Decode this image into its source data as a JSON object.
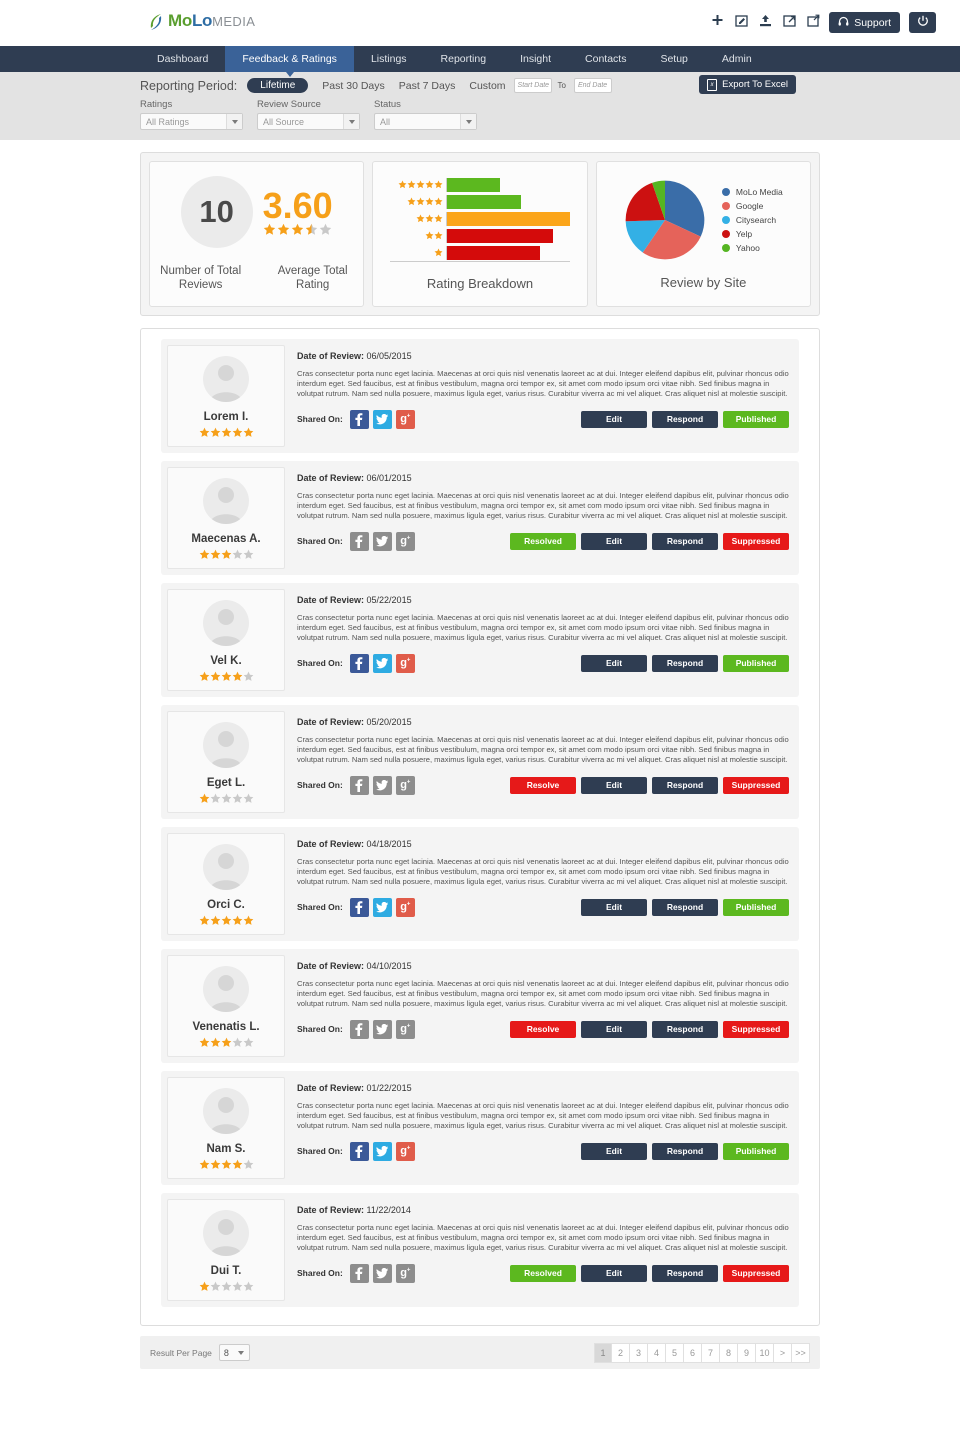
{
  "header": {
    "logo": {
      "part1": "Mo",
      "part2": "Lo",
      "part3": "MEDIA",
      "mark_icon": "swoosh-logo-icon"
    },
    "icons": [
      {
        "name": "add-icon",
        "glyph": "plus"
      },
      {
        "name": "compose-icon",
        "glyph": "edit-square"
      },
      {
        "name": "upload-icon",
        "glyph": "upload"
      },
      {
        "name": "external-link-icon",
        "glyph": "open-external"
      },
      {
        "name": "edit-external-icon",
        "glyph": "edit-external"
      }
    ],
    "support_label": "Support",
    "support_icon": "headset-icon",
    "power_icon": "power-icon"
  },
  "nav": {
    "items": [
      {
        "label": "Dashboard",
        "active": false
      },
      {
        "label": "Feedback & Ratings",
        "active": true
      },
      {
        "label": "Listings",
        "active": false
      },
      {
        "label": "Reporting",
        "active": false
      },
      {
        "label": "Insight",
        "active": false
      },
      {
        "label": "Contacts",
        "active": false
      },
      {
        "label": "Setup",
        "active": false
      },
      {
        "label": "Admin",
        "active": false
      }
    ],
    "active_color": "#3a6298",
    "bar_color": "#2f3d52"
  },
  "reporting_period": {
    "label": "Reporting Period:",
    "selected": "Lifetime",
    "options": [
      "Lifetime",
      "Past 30 Days",
      "Past 7 Days",
      "Custom"
    ],
    "start_date_placeholder": "Start Date",
    "to_label": "To",
    "end_date_placeholder": "End Date",
    "export_label": "Export To Excel",
    "export_icon": "excel-file-icon"
  },
  "filters": [
    {
      "label": "Ratings",
      "value": "All Ratings",
      "name": "ratings-filter"
    },
    {
      "label": "Review Source",
      "value": "All Source",
      "name": "review-source-filter"
    },
    {
      "label": "Status",
      "value": "All",
      "name": "status-filter"
    }
  ],
  "stats": {
    "total_reviews_value": "10",
    "total_reviews_label": "Number of Total Reviews",
    "average_rating_value": "3.60",
    "average_rating_label": "Average Total Rating",
    "average_rating_stars": 3.5,
    "accent_orange": "#f6a01a"
  },
  "chart_data": [
    {
      "type": "bar",
      "title": "Rating Breakdown",
      "orientation": "horizontal",
      "categories": [
        "5 stars",
        "4 stars",
        "3 stars",
        "2 stars",
        "1 star"
      ],
      "values": [
        43,
        60,
        100,
        86,
        76
      ],
      "colors": [
        "#5cb81f",
        "#5cb81f",
        "#fba51a",
        "#d40b0b",
        "#d40b0b"
      ],
      "xlabel": "",
      "ylabel": "",
      "xlim": [
        0,
        100
      ],
      "grid": false,
      "legend": false
    },
    {
      "type": "pie",
      "title": "Review by Site",
      "labels": [
        "MoLo Media",
        "Google",
        "Citysearch",
        "Yelp",
        "Yahoo"
      ],
      "values": [
        30,
        26,
        14,
        19,
        5
      ],
      "colors": [
        "#3a6da8",
        "#e5635a",
        "#33b0e5",
        "#cc1111",
        "#55b522"
      ],
      "legend": "right"
    }
  ],
  "reviews_section": {
    "date_label": "Date of Review:",
    "shared_on_label": "Shared On:",
    "body_text": "Cras consectetur porta nunc eget lacinia. Maecenas at orci quis nisl venenatis laoreet ac at dui. Integer eleifend dapibus elit, pulvinar rhoncus odio interdum eget. Sed faucibus, est at finibus vestibulum, magna orci tempor ex, sit amet com modo ipsum orci vitae nibh. Sed finibus magna in volutpat rutrum. Nam sed nulla posuere, maximus ligula eget, varius risus. Curabitur viverra ac mi vel aliquet. Cras aliquet nisl at molestie suscipit.",
    "social": [
      {
        "name": "facebook-share-icon",
        "glyph": "f"
      },
      {
        "name": "twitter-share-icon",
        "glyph": "t"
      },
      {
        "name": "googleplus-share-icon",
        "glyph": "g"
      }
    ],
    "reviews": [
      {
        "name": "Lorem I.",
        "date": "06/05/2015",
        "stars": 5,
        "social_on": true,
        "buttons": [
          {
            "label": "Edit",
            "style": "dark",
            "name": "edit-button"
          },
          {
            "label": "Respond",
            "style": "dark",
            "name": "respond-button"
          },
          {
            "label": "Published",
            "style": "green",
            "name": "published-status-button"
          }
        ]
      },
      {
        "name": "Maecenas A.",
        "date": "06/01/2015",
        "stars": 3,
        "social_on": false,
        "buttons": [
          {
            "label": "Resolved",
            "style": "green",
            "name": "resolved-button"
          },
          {
            "label": "Edit",
            "style": "dark",
            "name": "edit-button"
          },
          {
            "label": "Respond",
            "style": "dark",
            "name": "respond-button"
          },
          {
            "label": "Suppressed",
            "style": "red",
            "name": "suppressed-status-button"
          }
        ]
      },
      {
        "name": "Vel K.",
        "date": "05/22/2015",
        "stars": 4,
        "social_on": true,
        "buttons": [
          {
            "label": "Edit",
            "style": "dark",
            "name": "edit-button"
          },
          {
            "label": "Respond",
            "style": "dark",
            "name": "respond-button"
          },
          {
            "label": "Published",
            "style": "green",
            "name": "published-status-button"
          }
        ]
      },
      {
        "name": "Eget L.",
        "date": "05/20/2015",
        "stars": 1,
        "social_on": false,
        "buttons": [
          {
            "label": "Resolve",
            "style": "red",
            "name": "resolve-button"
          },
          {
            "label": "Edit",
            "style": "dark",
            "name": "edit-button"
          },
          {
            "label": "Respond",
            "style": "dark",
            "name": "respond-button"
          },
          {
            "label": "Suppressed",
            "style": "red",
            "name": "suppressed-status-button"
          }
        ]
      },
      {
        "name": "Orci C.",
        "date": "04/18/2015",
        "stars": 5,
        "social_on": true,
        "buttons": [
          {
            "label": "Edit",
            "style": "dark",
            "name": "edit-button"
          },
          {
            "label": "Respond",
            "style": "dark",
            "name": "respond-button"
          },
          {
            "label": "Published",
            "style": "green",
            "name": "published-status-button"
          }
        ]
      },
      {
        "name": "Venenatis L.",
        "date": "04/10/2015",
        "stars": 3,
        "social_on": false,
        "buttons": [
          {
            "label": "Resolve",
            "style": "red",
            "name": "resolve-button"
          },
          {
            "label": "Edit",
            "style": "dark",
            "name": "edit-button"
          },
          {
            "label": "Respond",
            "style": "dark",
            "name": "respond-button"
          },
          {
            "label": "Suppressed",
            "style": "red",
            "name": "suppressed-status-button"
          }
        ]
      },
      {
        "name": "Nam S.",
        "date": "01/22/2015",
        "stars": 4,
        "social_on": true,
        "buttons": [
          {
            "label": "Edit",
            "style": "dark",
            "name": "edit-button"
          },
          {
            "label": "Respond",
            "style": "dark",
            "name": "respond-button"
          },
          {
            "label": "Published",
            "style": "green",
            "name": "published-status-button"
          }
        ]
      },
      {
        "name": "Dui T.",
        "date": "11/22/2014",
        "stars": 1,
        "social_on": false,
        "buttons": [
          {
            "label": "Resolved",
            "style": "green",
            "name": "resolved-button"
          },
          {
            "label": "Edit",
            "style": "dark",
            "name": "edit-button"
          },
          {
            "label": "Respond",
            "style": "dark",
            "name": "respond-button"
          },
          {
            "label": "Suppressed",
            "style": "red",
            "name": "suppressed-status-button"
          }
        ]
      }
    ]
  },
  "footer": {
    "result_per_page_label": "Result Per Page",
    "result_per_page_value": "8",
    "pages": [
      "1",
      "2",
      "3",
      "4",
      "5",
      "6",
      "7",
      "8",
      "9",
      "10",
      ">",
      ">>"
    ],
    "active_page": "1"
  }
}
